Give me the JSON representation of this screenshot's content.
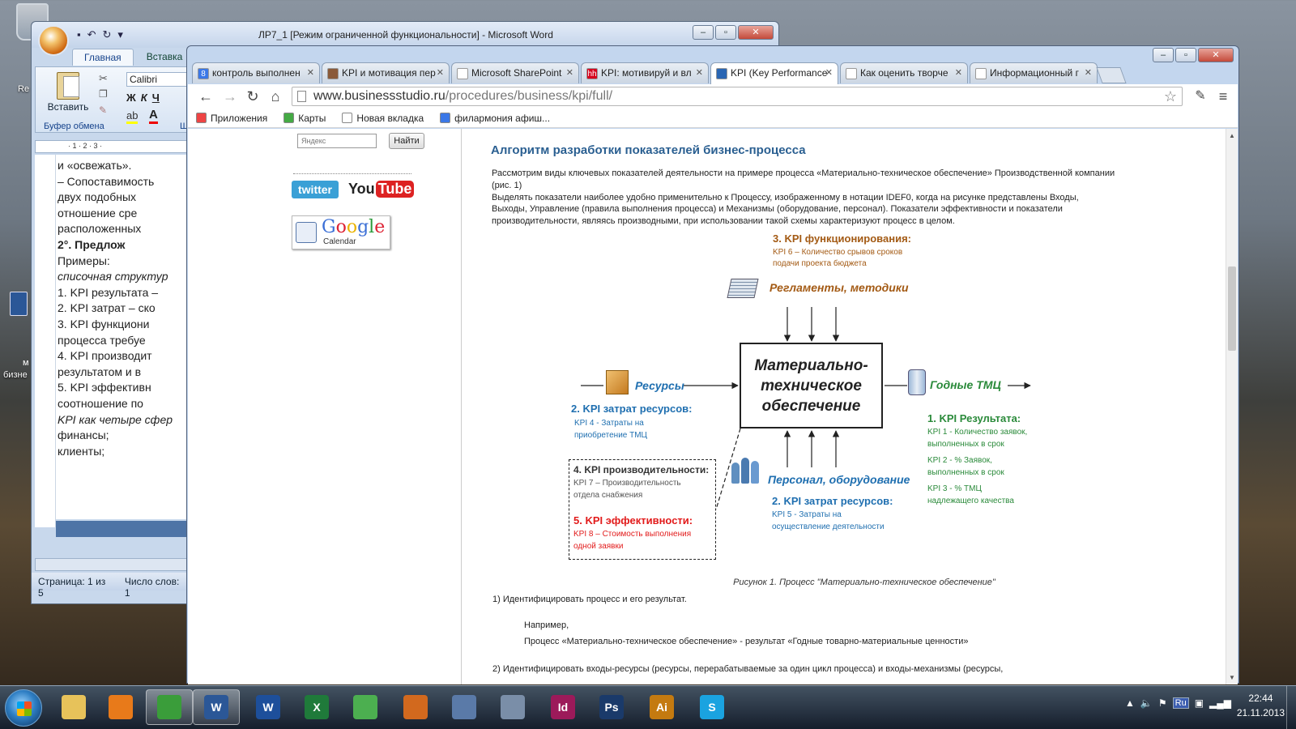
{
  "desktop": {
    "icons": [
      {
        "label": "Re",
        "top": 0
      },
      {
        "label": "бизне",
        "top": 0
      }
    ],
    "word_icon_label": "м"
  },
  "word": {
    "title": "ЛР7_1 [Режим ограниченной функциональности] - Microsoft Word",
    "tabs": [
      "Главная",
      "Вставка"
    ],
    "paste_label": "Вставить",
    "clipboard_group": "Буфер обмена",
    "font_name": "Calibri",
    "format_buttons": [
      "Ж",
      "К",
      "Ч"
    ],
    "ruler_marks": "· 1 · 2 · 3 ·",
    "group_cut": "Ш",
    "doc_lines": [
      {
        "text": "и «освежать».",
        "style": "normal"
      },
      {
        "text": "–   Сопоставимость",
        "style": "normal"
      },
      {
        "text": "     двух подобных",
        "style": "normal"
      },
      {
        "text": "     отношение  сре",
        "style": "normal"
      },
      {
        "text": "     расположенных",
        "style": "normal"
      },
      {
        "text": "          2°.   Предлож",
        "style": "bold"
      },
      {
        "text": "Примеры:",
        "style": "normal"
      },
      {
        "text": "списочная структур",
        "style": "italic"
      },
      {
        "text": "1.   KPI результата –",
        "style": "normal"
      },
      {
        "text": "2.   KPI затрат  –  ско",
        "style": "normal"
      },
      {
        "text": "3.   KPI   функциони",
        "style": "normal"
      },
      {
        "text": "     процесса требуе",
        "style": "normal"
      },
      {
        "text": "4.   KPI   производит",
        "style": "normal"
      },
      {
        "text": "     результатом и в",
        "style": "normal"
      },
      {
        "text": "5.   KPI    эффективн",
        "style": "normal"
      },
      {
        "text": "     соотношение по",
        "style": "normal"
      },
      {
        "text": "KPI как четыре сфер",
        "style": "italic"
      },
      {
        "text": "     финансы;",
        "style": "normal"
      },
      {
        "text": "     клиенты;",
        "style": "normal"
      }
    ],
    "status_page": "Страница: 1 из 5",
    "status_words": "Число слов: 1"
  },
  "chrome": {
    "tabs": [
      {
        "label": "контроль выполнен",
        "fav": "8",
        "color": "#3b78e7",
        "active": false
      },
      {
        "label": "KPI и мотивация пер",
        "fav": "",
        "color": "#8a5a3a",
        "active": false
      },
      {
        "label": "Microsoft SharePoint",
        "fav": "",
        "color": "#ffffff",
        "active": false
      },
      {
        "label": "KPI: мотивируй и вл",
        "fav": "hh",
        "color": "#d6001c",
        "active": false
      },
      {
        "label": "KPI (Key Performance",
        "fav": "",
        "color": "#2a66b3",
        "active": true
      },
      {
        "label": "Как оценить творче",
        "fav": "",
        "color": "#ffffff",
        "active": false
      },
      {
        "label": "Информационный г",
        "fav": "",
        "color": "#ffffff",
        "active": false
      }
    ],
    "url_host": "www.businessstudio.ru",
    "url_path": "/procedures/business/kpi/full/",
    "bookmarks": [
      {
        "label": "Приложения",
        "color": "#e44"
      },
      {
        "label": "Карты",
        "color": "#4a4"
      },
      {
        "label": "Новая вкладка",
        "color": "#fff"
      },
      {
        "label": "филармония афиш...",
        "color": "#3b78e7"
      }
    ]
  },
  "site": {
    "search_placeholder": "Яндекс",
    "search_button": "Найти",
    "twitter": "twitter",
    "youtube_you": "You",
    "youtube_tube": "Tube",
    "gcal_google": "Google",
    "gcal_calendar": "Calendar",
    "article_title": "Алгоритм разработки показателей бизнес-процесса",
    "intro_paragraph_1": "Рассмотрим виды ключевых показателей деятельности на примере процесса «Материально-техническое обеспечение» Производственной компании (рис. 1)",
    "intro_paragraph_2": "Выделять показатели наиболее удобно применительно к Процессу, изображенному в нотации IDEF0, когда на рисунке представлены Входы, Выходы, Управление (правила выполнения процесса) и Механизмы (оборудование, персонал). Показатели эффективности и показатели производительности, являясь производными, при использовании такой схемы характеризуют процесс в целом.",
    "figure_caption": "Рисунок 1. Процесс \"Материально-техническое обеспечение\"",
    "step1": "1) Идентифицировать процесс и его результат.",
    "example_label": "Например,",
    "example_text": "Процесс «Материально-техническое обеспечение» - результат «Годные товарно-материальные ценности»",
    "step2": "2) Идентифицировать входы-ресурсы (ресурсы, перерабатываемые за один цикл процесса) и входы-механизмы (ресурсы,"
  },
  "diagram": {
    "process_name": "Материально-техническое обеспечение",
    "kpi3_title": "3. KPI функционирования:",
    "kpi3_line1": "KPI 6 – Количество срывов сроков",
    "kpi3_line2": "подачи проекта бюджета",
    "controls_label": "Регламенты, методики",
    "inputs_label": "Ресурсы",
    "outputs_label": "Годные ТМЦ",
    "mechanisms_label": "Персонал, оборудование",
    "kpi2a_title": "2. KPI затрат ресурсов:",
    "kpi2a_line1": "KPI 4 - Затраты на",
    "kpi2a_line2": "приобретение ТМЦ",
    "kpi1_title": "1. KPI Результата:",
    "kpi1_a1": "KPI 1 - Количество заявок,",
    "kpi1_a2": "выполненных в срок",
    "kpi1_b1": "KPI 2 - % Заявок,",
    "kpi1_b2": "выполненных в срок",
    "kpi1_c1": "KPI 3  - % ТМЦ",
    "kpi1_c2": "надлежащего качества",
    "kpi4_title": "4. KPI производительности:",
    "kpi4_line1": "KPI 7 – Производительность",
    "kpi4_line2": "отдела снабжения",
    "kpi5_title": "5. KPI эффективности:",
    "kpi5_line1": "KPI 8 – Стоимость выполнения",
    "kpi5_line2": "одной заявки",
    "kpi2b_title": "2. KPI затрат ресурсов:",
    "kpi2b_line1": "KPI 5 - Затраты на",
    "kpi2b_line2": "осуществление деятельности"
  },
  "taskbar": {
    "apps": [
      {
        "name": "explorer",
        "label": "",
        "color": "#e7c25a"
      },
      {
        "name": "media-player",
        "label": "",
        "color": "#e87a1a"
      },
      {
        "name": "chrome",
        "label": "",
        "color": "#3a9d3a"
      },
      {
        "name": "word-doc",
        "label": "W",
        "color": "#2b5797"
      },
      {
        "name": "word",
        "label": "W",
        "color": "#1d4f9b"
      },
      {
        "name": "excel",
        "label": "X",
        "color": "#1f7a3a"
      },
      {
        "name": "app-green",
        "label": "",
        "color": "#4caf50"
      },
      {
        "name": "matlab",
        "label": "",
        "color": "#d2691e"
      },
      {
        "name": "virtualbox",
        "label": "",
        "color": "#5a7aa8"
      },
      {
        "name": "calculator",
        "label": "",
        "color": "#7a8ea8"
      },
      {
        "name": "indesign",
        "label": "Id",
        "color": "#9c1a5a"
      },
      {
        "name": "photoshop",
        "label": "Ps",
        "color": "#1a3a6a"
      },
      {
        "name": "illustrator",
        "label": "Ai",
        "color": "#c47a10"
      },
      {
        "name": "skype",
        "label": "S",
        "color": "#1aa3e0"
      }
    ],
    "lang": "Ru",
    "time": "22:44",
    "date": "21.11.2013"
  }
}
